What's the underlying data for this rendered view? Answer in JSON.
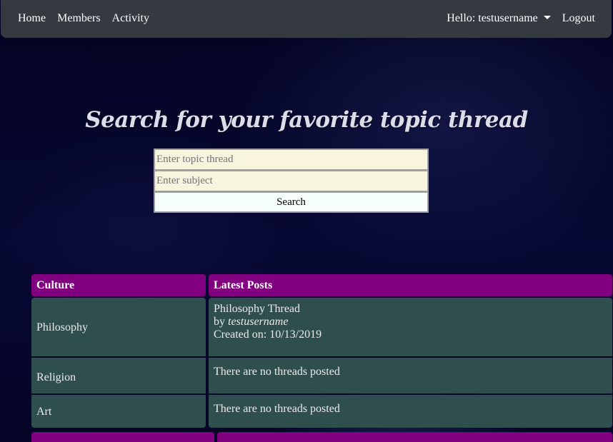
{
  "nav": {
    "left_links": [
      "Home",
      "Members",
      "Activity"
    ],
    "greeting": "Hello: testusername",
    "logout": "Logout"
  },
  "hero": {
    "title": "Search for your favorite topic thread"
  },
  "search": {
    "topic_placeholder": "Enter topic thread",
    "topic_value": "",
    "subject_placeholder": "Enter subject",
    "subject_value": "",
    "button_label": "Search"
  },
  "forum": {
    "headers": [
      "Culture",
      "Latest Posts"
    ],
    "rows": [
      {
        "category": "Philosophy",
        "post_title": "Philosophy Thread",
        "by_label": "by",
        "author": "testusername",
        "created": "Created on: 10/13/2019"
      },
      {
        "category": "Religion",
        "no_posts": "There are no threads posted"
      },
      {
        "category": "Art",
        "no_posts": "There are no threads posted"
      }
    ]
  },
  "colors": {
    "navbar": "#343a40",
    "header_row": "#800080",
    "body_row": "#2f4f4f",
    "input_bg": "#f7f5dd",
    "button_bg": "#f6fffb",
    "page_bg": "#05052a"
  }
}
